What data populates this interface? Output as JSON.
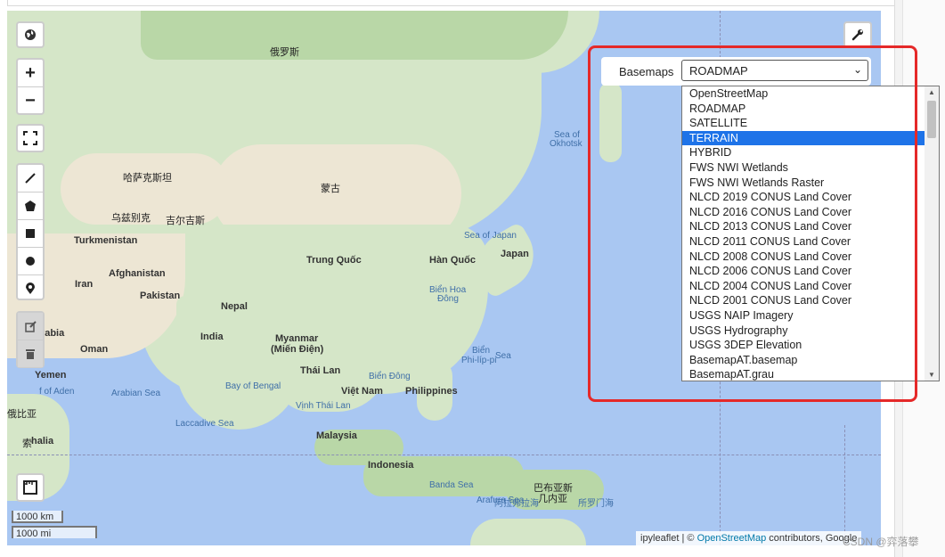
{
  "map": {
    "labels": {
      "russia": "俄罗斯",
      "kazakhstan": "哈萨克斯坦",
      "mongolia": "蒙古",
      "uzbekistan": "乌兹别克",
      "kyrgyzstan": "吉尔吉斯",
      "turkmenistan": "Turkmenistan",
      "afghanistan": "Afghanistan",
      "iran": "Iran",
      "pakistan": "Pakistan",
      "nepal": "Nepal",
      "china": "Trung Quốc",
      "korea": "Hàn Quốc",
      "japan": "Japan",
      "sea_of_japan": "Sea of Japan",
      "sea_of_okhotsk_1": "Sea of",
      "sea_of_okhotsk_2": "Okhotsk",
      "east_china_sea_1": "Biển Hoa",
      "east_china_sea_2": "Đông",
      "philippine_sea_1": "Biển",
      "philippine_sea_2": "Phi-líp-pi",
      "philippine_sea_3": "Sea",
      "saudi": "Arabia",
      "oman": "Oman",
      "yemen": "Yemen",
      "gulf_aden": "f of Aden",
      "arabian_sea": "Arabian Sea",
      "india": "India",
      "bay_bengal": "Bay of Bengal",
      "myanmar_1": "Myanmar",
      "myanmar_2": "(Miến Điện)",
      "thailand": "Thái Lan",
      "vietnam": "Việt Nam",
      "south_china_sea": "Biển Đông",
      "philippines": "Philippines",
      "gulf_thailand": "Vịnh Thái Lan",
      "laccadive": "Laccadive Sea",
      "malaysia": "Malaysia",
      "indonesia": "Indonesia",
      "banda_sea": "Banda Sea",
      "png_1": "巴布亚新",
      "png_2": "几内亚",
      "arafura": "Arafura Sea",
      "arafura_cn": "阿拉弗拉海",
      "solomon": "所罗门海",
      "ethiopia": "俄比亚",
      "somalia": "索马里",
      "somalia_suffix": "halia",
      "somalia_prefix": "索"
    }
  },
  "controls": {
    "globe_icon": "globe-icon",
    "zoom_in": "+",
    "zoom_out": "−",
    "fullscreen_icon": "fullscreen-icon",
    "wrench_icon": "wrench-icon"
  },
  "basemaps": {
    "label": "Basemaps",
    "selected": "ROADMAP",
    "highlighted": "TERRAIN",
    "options": [
      "OpenStreetMap",
      "ROADMAP",
      "SATELLITE",
      "TERRAIN",
      "HYBRID",
      "FWS NWI Wetlands",
      "FWS NWI Wetlands Raster",
      "NLCD 2019 CONUS Land Cover",
      "NLCD 2016 CONUS Land Cover",
      "NLCD 2013 CONUS Land Cover",
      "NLCD 2011 CONUS Land Cover",
      "NLCD 2008 CONUS Land Cover",
      "NLCD 2006 CONUS Land Cover",
      "NLCD 2004 CONUS Land Cover",
      "NLCD 2001 CONUS Land Cover",
      "USGS NAIP Imagery",
      "USGS Hydrography",
      "USGS 3DEP Elevation",
      "BasemapAT.basemap",
      "BasemapAT.grau"
    ]
  },
  "scale": {
    "km": "1000 km",
    "mi": "1000 mi"
  },
  "attribution": {
    "prefix": "ipyleaflet | ©",
    "osm": "OpenStreetMap",
    "suffix": "contributors, Google"
  },
  "watermark": "CSDN @弈落攀"
}
